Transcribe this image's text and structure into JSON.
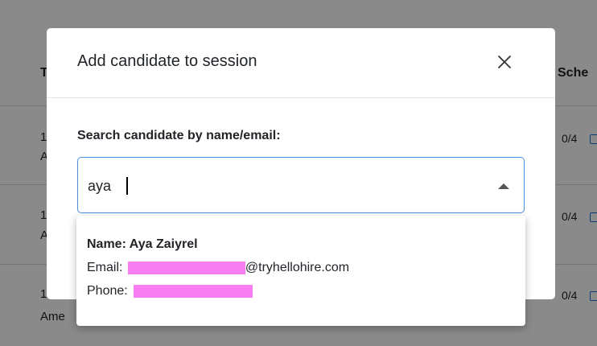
{
  "background": {
    "header_first_col": "T",
    "header_schedule": "Sche",
    "rows": [
      {
        "line1": "1",
        "line2": "A",
        "fraction": "0/4"
      },
      {
        "line1": "1",
        "line2": "A",
        "fraction": "0/4"
      },
      {
        "line1": "1",
        "line2": "Ame",
        "fraction": "0/4"
      }
    ]
  },
  "modal": {
    "title": "Add candidate to session",
    "close_icon": "close-icon",
    "search_label": "Search candidate by name/email:",
    "search_value": "aya",
    "dropdown_icon": "caret-up-icon"
  },
  "results": [
    {
      "name": "Name: Aya Zaiyrel",
      "email_prefix": "Email: ",
      "email_suffix": "@tryhellohire.com",
      "phone_prefix": "Phone: "
    }
  ],
  "colors": {
    "accent_border": "#4a90e2",
    "redaction": "#f77df1",
    "edit_icon": "#1e6fd9"
  }
}
